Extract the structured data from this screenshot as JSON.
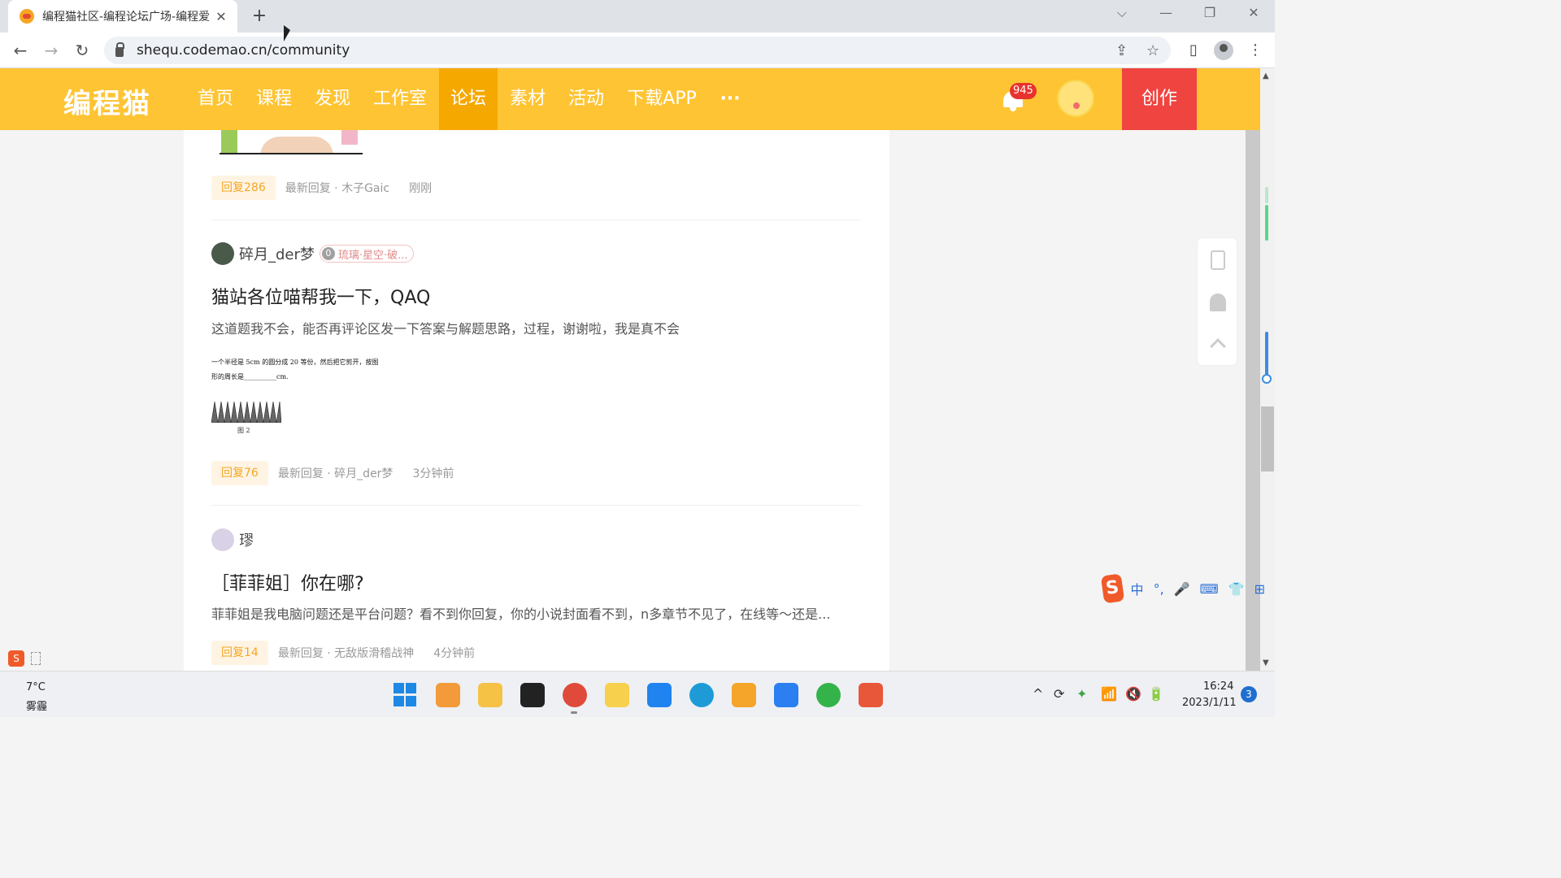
{
  "browser": {
    "tab_title": "编程猫社区-编程论坛广场-编程爱",
    "tab_close": "✕",
    "new_tab": "+",
    "url": "shequ.codemao.cn/community",
    "back": "←",
    "forward": "→",
    "reload": "↻",
    "share_icon": "⇪",
    "star_icon": "☆",
    "side_panel_icon": "▯",
    "menu_icon": "⋮",
    "window_controls": {
      "dropdown": "⌵",
      "minimize": "—",
      "restore": "❐",
      "close": "✕"
    }
  },
  "site": {
    "logo": "编程猫",
    "nav": [
      "首页",
      "课程",
      "发现",
      "工作室",
      "论坛",
      "素材",
      "活动",
      "下载APP",
      "···"
    ],
    "active_nav": "论坛",
    "notification_count": "945",
    "create_label": "创作"
  },
  "posts": [
    {
      "reply_label": "回复286",
      "latest_reply": "最新回复 · 木子Gaic",
      "time": "刚刚"
    },
    {
      "author": "碎月_der梦",
      "level": "0",
      "badge_text": "琉璃·星空·破...",
      "title": "猫站各位喵帮我一下，QAQ",
      "desc": "这道题我不会，能否再评论区发一下答案与解题思路，过程，谢谢啦，我是真不会",
      "image_text_line1": "一个半径是 5cm 的圆分成 20 等份，然后把它剪开，按图",
      "image_text_line2": "形的周长是__________cm.",
      "image_fig_label": "图 2",
      "reply_label": "回复76",
      "latest_reply": "最新回复 · 碎月_der梦",
      "time": "3分钟前"
    },
    {
      "author": "璆",
      "title": "［菲菲姐］你在哪?",
      "desc": "菲菲姐是我电脑问题还是平台问题？看不到你回复，你的小说封面看不到，n多章节不见了，在线等～还是...",
      "reply_label": "回复14",
      "latest_reply": "最新回复 · 无敌版滑稽战神",
      "time": "4分钟前"
    }
  ],
  "ime": {
    "logo": "S",
    "items": [
      "中",
      "°,",
      "🎤",
      "⌨",
      "👕",
      "⊞"
    ]
  },
  "taskbar": {
    "temp": "7°C",
    "weather": "雾霾",
    "time": "16:24",
    "date": "2023/1/11",
    "notifications": "3",
    "tray": [
      "^",
      "⟳",
      "✦",
      "📶",
      "🔇",
      "🔋"
    ]
  }
}
